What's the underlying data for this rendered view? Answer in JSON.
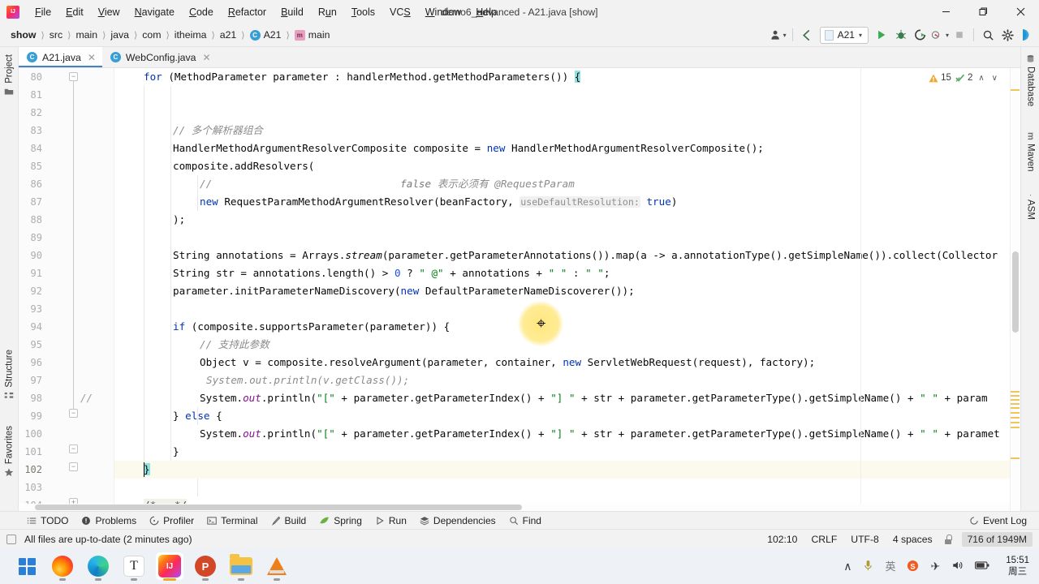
{
  "titlebar": {
    "app_icon": "intellij-idea-logo",
    "window_title": "demo6_advanced - A21.java [show]",
    "menus": [
      {
        "mnemonic": "F",
        "rest": "ile"
      },
      {
        "mnemonic": "E",
        "rest": "dit"
      },
      {
        "mnemonic": "V",
        "rest": "iew"
      },
      {
        "mnemonic": "N",
        "rest": "avigate"
      },
      {
        "mnemonic": "C",
        "rest": "ode"
      },
      {
        "mnemonic": "R",
        "rest": "efactor"
      },
      {
        "mnemonic": "B",
        "rest": "uild"
      },
      {
        "mnemonic": "R",
        "rest": "un",
        "pre": "R",
        "mid": "u",
        "post": "n"
      },
      {
        "mnemonic": "T",
        "rest": "ools"
      },
      {
        "mnemonic": "VCS",
        "rest": ""
      },
      {
        "mnemonic": "W",
        "rest": "indow"
      },
      {
        "mnemonic": "H",
        "rest": "elp"
      }
    ],
    "minimize_label": "─",
    "maximize_label": "❐",
    "close_label": "✕"
  },
  "navbar": {
    "breadcrumbs": [
      {
        "label": "show",
        "icon": "",
        "bold": true
      },
      {
        "label": "src",
        "icon": ""
      },
      {
        "label": "main",
        "icon": ""
      },
      {
        "label": "java",
        "icon": ""
      },
      {
        "label": "com",
        "icon": ""
      },
      {
        "label": "itheima",
        "icon": ""
      },
      {
        "label": "a21",
        "icon": ""
      },
      {
        "label": "A21",
        "icon": "class-icon"
      },
      {
        "label": "main",
        "icon": "method-icon"
      }
    ],
    "separator": "›",
    "toolbar": {
      "profile_icon": "user-profile-icon",
      "back_icon": "back-arrow-icon",
      "run_config_label": "A21",
      "run_icon": "run-icon",
      "debug_icon": "debug-icon",
      "run_coverage_icon": "run-with-coverage-icon",
      "profiler_icon": "profiler-icon",
      "stop_icon": "stop-icon",
      "search_icon": "search-everywhere-icon",
      "settings_icon": "settings-gear-icon",
      "updates_icon": "updates-icon"
    }
  },
  "left_stripe": [
    {
      "label": "Project",
      "icon": "project-folder-icon"
    },
    {
      "label": "Structure",
      "icon": "structure-icon"
    },
    {
      "label": "Favorites",
      "icon": "star-icon"
    }
  ],
  "right_stripe": [
    {
      "label": "Database",
      "icon": "database-icon"
    },
    {
      "label": "Maven",
      "icon": "maven-icon"
    },
    {
      "label": "ASM",
      "icon": "asm-icon"
    }
  ],
  "tabs": [
    {
      "label": "A21.java",
      "icon": "java-class-icon",
      "active": true,
      "close": "✕"
    },
    {
      "label": "WebConfig.java",
      "icon": "java-class-icon",
      "active": false,
      "close": "✕"
    }
  ],
  "editor": {
    "first_line": 80,
    "inspections": {
      "warning_icon": "warning-triangle-icon",
      "warning_count": "15",
      "check_icon": "inspections-ok-icon",
      "check_count": "2",
      "up_arrow": "∧",
      "down_arrow": "∨"
    },
    "lines": [
      {
        "n": 80,
        "text": "        for (MethodParameter parameter : handlerMethod.getMethodParameters()) {"
      },
      {
        "n": 81,
        "text": ""
      },
      {
        "n": 82,
        "text": ""
      },
      {
        "n": 83,
        "text": "            // 多个解析器组合"
      },
      {
        "n": 84,
        "text": "            HandlerMethodArgumentResolverComposite composite = new HandlerMethodArgumentResolverComposite();"
      },
      {
        "n": 85,
        "text": "            composite.addResolvers("
      },
      {
        "n": 86,
        "text": "                    //                                  false 表示必须有 @RequestParam"
      },
      {
        "n": 87,
        "text": "                    new RequestParamMethodArgumentResolver(beanFactory,  useDefaultResolution: true)"
      },
      {
        "n": 88,
        "text": "            );"
      },
      {
        "n": 89,
        "text": ""
      },
      {
        "n": 90,
        "text": "            String annotations = Arrays.stream(parameter.getParameterAnnotations()).map(a -> a.annotationType().getSimpleName()).collect(Collector"
      },
      {
        "n": 91,
        "text": "            String str = annotations.length() > 0 ? \" @\" + annotations + \" \" : \" \";"
      },
      {
        "n": 92,
        "text": "            parameter.initParameterNameDiscovery(new DefaultParameterNameDiscoverer());"
      },
      {
        "n": 93,
        "text": ""
      },
      {
        "n": 94,
        "text": "            if (composite.supportsParameter(parameter)) {"
      },
      {
        "n": 95,
        "text": "                // 支持此参数"
      },
      {
        "n": 96,
        "text": "                Object v = composite.resolveArgument(parameter, container, new ServletWebRequest(request), factory);"
      },
      {
        "n": 97,
        "text": "                  System.out.println(v.getClass());"
      },
      {
        "n": 98,
        "text": "                System.out.println(\"[\" + parameter.getParameterIndex() + \"] \" + str + parameter.getParameterType().getSimpleName() + \" \" + param"
      },
      {
        "n": 99,
        "text": "            } else {"
      },
      {
        "n": 100,
        "text": "                System.out.println(\"[\" + parameter.getParameterIndex() + \"] \" + str + parameter.getParameterType().getSimpleName() + \" \" + paramet"
      },
      {
        "n": 101,
        "text": "            }"
      },
      {
        "n": 102,
        "text": "        }"
      },
      {
        "n": 103,
        "text": ""
      },
      {
        "n": 104,
        "text": "    /*...*/"
      }
    ],
    "gutter_comment_line_97": "//",
    "current_line": 102,
    "inline_hint_86": "false 表示必须有 @RequestParam",
    "inline_hint_87": "useDefaultResolution:",
    "folded_text_104": "/*...*/"
  },
  "tool_window_bar": {
    "items": [
      {
        "label": "TODO",
        "icon": "todo-list-icon"
      },
      {
        "label": "Problems",
        "icon": "problems-icon"
      },
      {
        "label": "Profiler",
        "icon": "profiler-icon"
      },
      {
        "label": "Terminal",
        "icon": "terminal-icon"
      },
      {
        "label": "Build",
        "icon": "build-hammer-icon"
      },
      {
        "label": "Spring",
        "icon": "spring-leaf-icon"
      },
      {
        "label": "Run",
        "icon": "run-triangle-icon"
      },
      {
        "label": "Dependencies",
        "icon": "dependencies-icon"
      },
      {
        "label": "Find",
        "icon": "find-magnifier-icon"
      }
    ],
    "event_log": {
      "label": "Event Log",
      "icon": "event-log-icon"
    }
  },
  "statusbar": {
    "build_icon": "build-status-icon",
    "message": "All files are up-to-date (2 minutes ago)",
    "caret_position": "102:10",
    "line_separator": "CRLF",
    "encoding": "UTF-8",
    "indent": "4 spaces",
    "lock_icon": "read-only-lock-icon",
    "memory": "716 of 1949M"
  },
  "taskbar": {
    "apps": [
      {
        "name": "start-windows-button",
        "icon": "windows-logo-icon",
        "active": false
      },
      {
        "name": "firefox",
        "icon": "firefox-icon",
        "active": false,
        "running": true
      },
      {
        "name": "microsoft-edge",
        "icon": "edge-icon",
        "active": false,
        "running": true
      },
      {
        "name": "typora",
        "icon": "typora-icon",
        "active": false,
        "running": true
      },
      {
        "name": "intellij-idea",
        "icon": "intellij-idea-icon",
        "active": true,
        "running": true
      },
      {
        "name": "powerpoint",
        "icon": "powerpoint-icon",
        "active": false,
        "running": true
      },
      {
        "name": "file-explorer",
        "icon": "folder-icon",
        "active": false,
        "running": true
      },
      {
        "name": "vlc",
        "icon": "vlc-cone-icon",
        "active": false,
        "running": true
      }
    ],
    "tray": [
      {
        "name": "show-hidden-icons",
        "glyph": "∧"
      },
      {
        "name": "microphone-icon",
        "glyph": "⚕"
      },
      {
        "name": "ime-chinese-icon",
        "glyph": "英"
      },
      {
        "name": "sogou-input-icon",
        "glyph": "S"
      },
      {
        "name": "airplane-mode-icon",
        "glyph": "✈"
      },
      {
        "name": "volume-icon",
        "glyph": "🔊"
      },
      {
        "name": "battery-icon",
        "glyph": "🔋"
      }
    ],
    "clock_time": "15:51",
    "clock_date": "周三"
  }
}
